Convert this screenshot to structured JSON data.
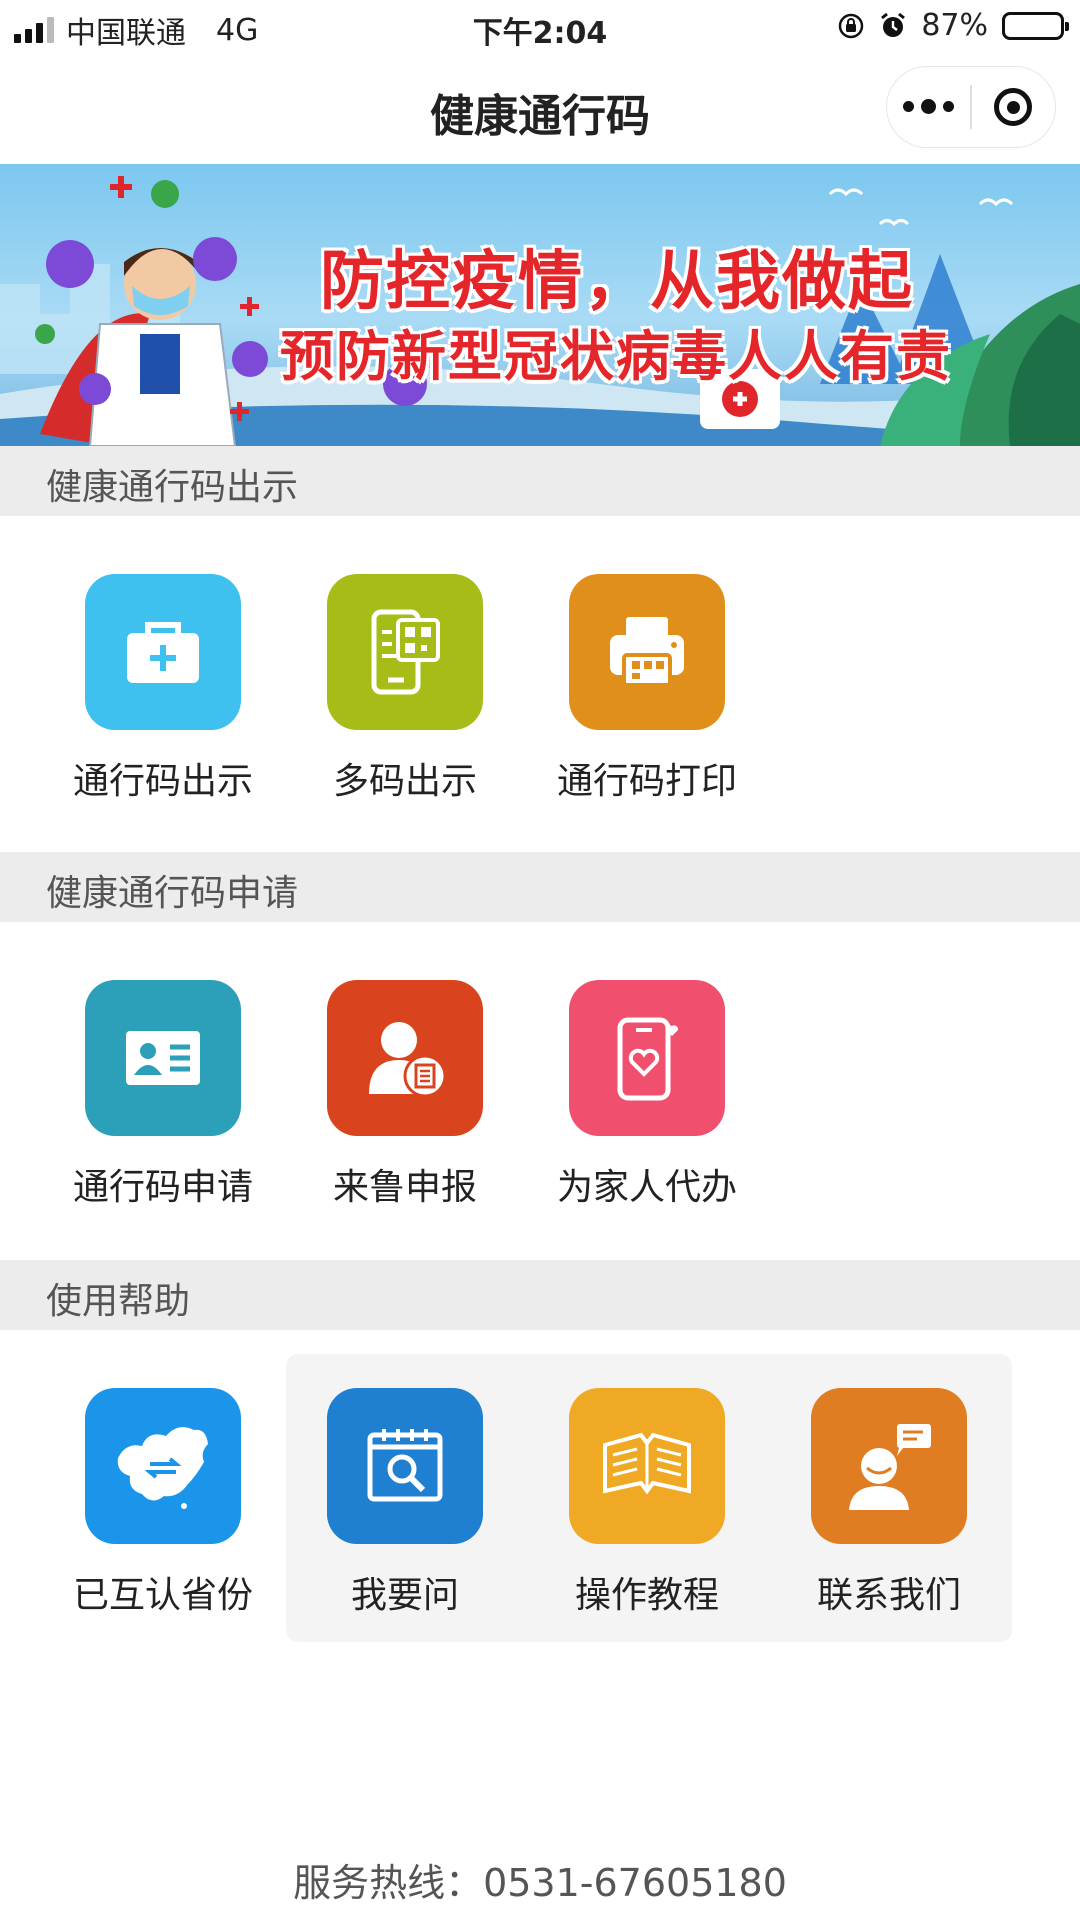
{
  "status_bar": {
    "carrier": "中国联通",
    "network": "4G",
    "time": "下午2:04",
    "battery": "87%",
    "battery_level": 0.87
  },
  "navbar": {
    "title": "健康通行码",
    "more_icon": "more-dots-icon",
    "close_icon": "target-icon"
  },
  "banner": {
    "line1": "防控疫情，从我做起",
    "line2": "预防新型冠状病毒人人有责"
  },
  "sections": [
    {
      "title": "健康通行码出示",
      "items": [
        {
          "label": "通行码出示",
          "icon": "medical-kit-icon",
          "color": "#3ec1ef"
        },
        {
          "label": "多码出示",
          "icon": "phone-qr-icon",
          "color": "#a7bc16"
        },
        {
          "label": "通行码打印",
          "icon": "printer-icon",
          "color": "#e0901a"
        }
      ]
    },
    {
      "title": "健康通行码申请",
      "items": [
        {
          "label": "通行码申请",
          "icon": "id-card-icon",
          "color": "#2c9fb9"
        },
        {
          "label": "来鲁申报",
          "icon": "user-report-icon",
          "color": "#d9441f"
        },
        {
          "label": "为家人代办",
          "icon": "phone-heart-icon",
          "color": "#f0506e"
        }
      ]
    },
    {
      "title": "使用帮助",
      "items": [
        {
          "label": "已互认省份",
          "icon": "china-map-icon",
          "color": "#1a95ea"
        },
        {
          "label": "我要问",
          "icon": "calendar-search-icon",
          "color": "#1f7fd1"
        },
        {
          "label": "操作教程",
          "icon": "open-book-icon",
          "color": "#f0a924"
        },
        {
          "label": "联系我们",
          "icon": "contact-chat-icon",
          "color": "#e07c22"
        }
      ]
    }
  ],
  "footer": {
    "hotline": "服务热线：0531-67605180"
  }
}
